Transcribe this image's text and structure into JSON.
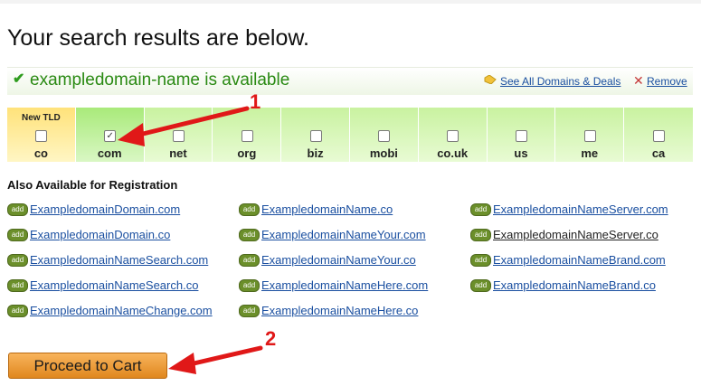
{
  "heading": "Your search results are below.",
  "result": {
    "check_icon": "check-icon",
    "availability": "exampledomain-name is available",
    "deals_link": "See All Domains & Deals",
    "remove_link": "Remove"
  },
  "tlds": [
    {
      "name": "co",
      "badge": "New TLD",
      "checked": false
    },
    {
      "name": "com",
      "checked": true
    },
    {
      "name": "net",
      "checked": false
    },
    {
      "name": "org",
      "checked": false
    },
    {
      "name": "biz",
      "checked": false
    },
    {
      "name": "mobi",
      "checked": false
    },
    {
      "name": "co.uk",
      "checked": false
    },
    {
      "name": "us",
      "checked": false
    },
    {
      "name": "me",
      "checked": false
    },
    {
      "name": "ca",
      "checked": false
    }
  ],
  "also": {
    "title": "Also Available for Registration",
    "add_label": "add",
    "columns": [
      [
        "ExampledomainDomain.com",
        "ExampledomainDomain.co",
        "ExampledomainNameSearch.com",
        "ExampledomainNameSearch.co",
        "ExampledomainNameChange.com"
      ],
      [
        "ExampledomainName.co",
        "ExampledomainNameYour.com",
        "ExampledomainNameYour.co",
        "ExampledomainNameHere.com",
        "ExampledomainNameHere.co"
      ],
      [
        "ExampledomainNameServer.com",
        "ExampledomainNameServer.co",
        "ExampledomainNameBrand.com",
        "ExampledomainNameBrand.co"
      ]
    ]
  },
  "cart_button": "Proceed to Cart",
  "annotations": {
    "one": "1",
    "two": "2"
  },
  "colors": {
    "available_green": "#2a8a13",
    "link_blue": "#1a4fa0",
    "annotation_red": "#e01818",
    "cart_orange": "#e0871e"
  }
}
